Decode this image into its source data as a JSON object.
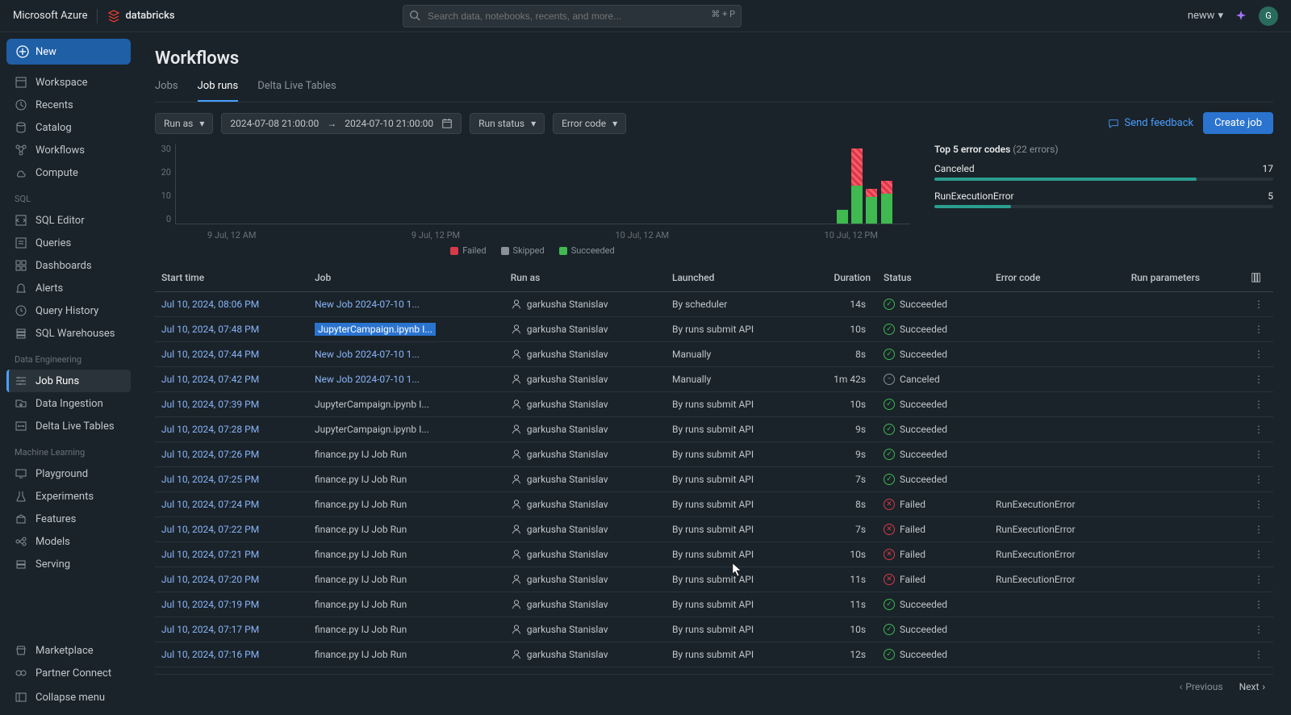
{
  "topbar": {
    "brand": "Microsoft Azure",
    "product": "databricks",
    "search_placeholder": "Search data, notebooks, recents, and more...",
    "kbd_hint": "⌘ + P",
    "workspace_menu": "neww",
    "avatar_letter": "G"
  },
  "sidebar": {
    "new_label": "New",
    "main_items": [
      {
        "id": "workspace",
        "label": "Workspace"
      },
      {
        "id": "recents",
        "label": "Recents"
      },
      {
        "id": "catalog",
        "label": "Catalog"
      },
      {
        "id": "workflows",
        "label": "Workflows"
      },
      {
        "id": "compute",
        "label": "Compute"
      }
    ],
    "sql_label": "SQL",
    "sql_items": [
      {
        "id": "sql-editor",
        "label": "SQL Editor"
      },
      {
        "id": "queries",
        "label": "Queries"
      },
      {
        "id": "dashboards",
        "label": "Dashboards"
      },
      {
        "id": "alerts",
        "label": "Alerts"
      },
      {
        "id": "query-history",
        "label": "Query History"
      },
      {
        "id": "sql-warehouses",
        "label": "SQL Warehouses"
      }
    ],
    "de_label": "Data Engineering",
    "de_items": [
      {
        "id": "job-runs",
        "label": "Job Runs",
        "active": true
      },
      {
        "id": "data-ingestion",
        "label": "Data Ingestion"
      },
      {
        "id": "dlt",
        "label": "Delta Live Tables"
      }
    ],
    "ml_label": "Machine Learning",
    "ml_items": [
      {
        "id": "playground",
        "label": "Playground"
      },
      {
        "id": "experiments",
        "label": "Experiments"
      },
      {
        "id": "features",
        "label": "Features"
      },
      {
        "id": "models",
        "label": "Models"
      },
      {
        "id": "serving",
        "label": "Serving"
      }
    ],
    "bottom_items": [
      {
        "id": "marketplace",
        "label": "Marketplace"
      },
      {
        "id": "partner",
        "label": "Partner Connect"
      }
    ],
    "collapse_label": "Collapse menu"
  },
  "page": {
    "title": "Workflows",
    "tabs": [
      {
        "id": "jobs",
        "label": "Jobs"
      },
      {
        "id": "job-runs",
        "label": "Job runs",
        "active": true
      },
      {
        "id": "dlt",
        "label": "Delta Live Tables"
      }
    ]
  },
  "filters": {
    "run_as_label": "Run as",
    "date_from": "2024-07-08 21:00:00",
    "date_to": "2024-07-10 21:00:00",
    "run_status_label": "Run status",
    "error_code_label": "Error code",
    "feedback_label": "Send feedback",
    "create_label": "Create job"
  },
  "chart_data": {
    "type": "bar",
    "ylim": [
      0,
      30
    ],
    "yticks": [
      0,
      10,
      20,
      30
    ],
    "x_labels": [
      "9 Jul, 12 AM",
      "9 Jul, 12 PM",
      "10 Jul, 12 AM",
      "10 Jul, 12 PM"
    ],
    "bars": [
      {
        "x_pct": 90,
        "succeeded": 5,
        "failed": 0
      },
      {
        "x_pct": 92,
        "succeeded": 14,
        "failed": 14
      },
      {
        "x_pct": 94,
        "succeeded": 10,
        "failed": 3
      },
      {
        "x_pct": 96,
        "succeeded": 11,
        "failed": 5
      }
    ],
    "legend": [
      {
        "id": "failed",
        "label": "Failed",
        "color": "#d73a49"
      },
      {
        "id": "skipped",
        "label": "Skipped",
        "color": "#8a9199"
      },
      {
        "id": "succeeded",
        "label": "Succeeded",
        "color": "#3fb950"
      }
    ]
  },
  "error_panel": {
    "title": "Top 5 error codes",
    "count_label": "(22 errors)",
    "rows": [
      {
        "name": "Canceled",
        "value": 17,
        "max": 22
      },
      {
        "name": "RunExecutionError",
        "value": 5,
        "max": 22
      }
    ]
  },
  "table": {
    "columns": [
      "Start time",
      "Job",
      "Run as",
      "Launched",
      "Duration",
      "Status",
      "Error code",
      "Run parameters"
    ],
    "user": "garkusha Stanislav",
    "rows": [
      {
        "start": "Jul 10, 2024, 08:06 PM",
        "job": "New Job 2024-07-10 1...",
        "job_link": true,
        "launched": "By scheduler",
        "duration": "14s",
        "status": "Succeeded",
        "error": ""
      },
      {
        "start": "Jul 10, 2024, 07:48 PM",
        "job": "JupyterCampaign.ipynb I...",
        "job_link": true,
        "job_hl": true,
        "launched": "By runs submit API",
        "duration": "10s",
        "status": "Succeeded",
        "error": ""
      },
      {
        "start": "Jul 10, 2024, 07:44 PM",
        "job": "New Job 2024-07-10 1...",
        "job_link": true,
        "launched": "Manually",
        "duration": "8s",
        "status": "Succeeded",
        "error": ""
      },
      {
        "start": "Jul 10, 2024, 07:42 PM",
        "job": "New Job 2024-07-10 1...",
        "job_link": true,
        "launched": "Manually",
        "duration": "1m 42s",
        "status": "Canceled",
        "error": ""
      },
      {
        "start": "Jul 10, 2024, 07:39 PM",
        "job": "JupyterCampaign.ipynb I...",
        "launched": "By runs submit API",
        "duration": "10s",
        "status": "Succeeded",
        "error": ""
      },
      {
        "start": "Jul 10, 2024, 07:28 PM",
        "job": "JupyterCampaign.ipynb I...",
        "launched": "By runs submit API",
        "duration": "9s",
        "status": "Succeeded",
        "error": ""
      },
      {
        "start": "Jul 10, 2024, 07:26 PM",
        "job": "finance.py IJ Job Run",
        "launched": "By runs submit API",
        "duration": "9s",
        "status": "Succeeded",
        "error": ""
      },
      {
        "start": "Jul 10, 2024, 07:25 PM",
        "job": "finance.py IJ Job Run",
        "launched": "By runs submit API",
        "duration": "7s",
        "status": "Succeeded",
        "error": ""
      },
      {
        "start": "Jul 10, 2024, 07:24 PM",
        "job": "finance.py IJ Job Run",
        "launched": "By runs submit API",
        "duration": "8s",
        "status": "Failed",
        "error": "RunExecutionError"
      },
      {
        "start": "Jul 10, 2024, 07:22 PM",
        "job": "finance.py IJ Job Run",
        "launched": "By runs submit API",
        "duration": "7s",
        "status": "Failed",
        "error": "RunExecutionError"
      },
      {
        "start": "Jul 10, 2024, 07:21 PM",
        "job": "finance.py IJ Job Run",
        "launched": "By runs submit API",
        "duration": "10s",
        "status": "Failed",
        "error": "RunExecutionError"
      },
      {
        "start": "Jul 10, 2024, 07:20 PM",
        "job": "finance.py IJ Job Run",
        "launched": "By runs submit API",
        "duration": "11s",
        "status": "Failed",
        "error": "RunExecutionError"
      },
      {
        "start": "Jul 10, 2024, 07:19 PM",
        "job": "finance.py IJ Job Run",
        "launched": "By runs submit API",
        "duration": "11s",
        "status": "Succeeded",
        "error": ""
      },
      {
        "start": "Jul 10, 2024, 07:17 PM",
        "job": "finance.py IJ Job Run",
        "launched": "By runs submit API",
        "duration": "10s",
        "status": "Succeeded",
        "error": ""
      },
      {
        "start": "Jul 10, 2024, 07:16 PM",
        "job": "finance.py IJ Job Run",
        "launched": "By runs submit API",
        "duration": "12s",
        "status": "Succeeded",
        "error": ""
      }
    ]
  },
  "pager": {
    "prev": "Previous",
    "next": "Next"
  }
}
